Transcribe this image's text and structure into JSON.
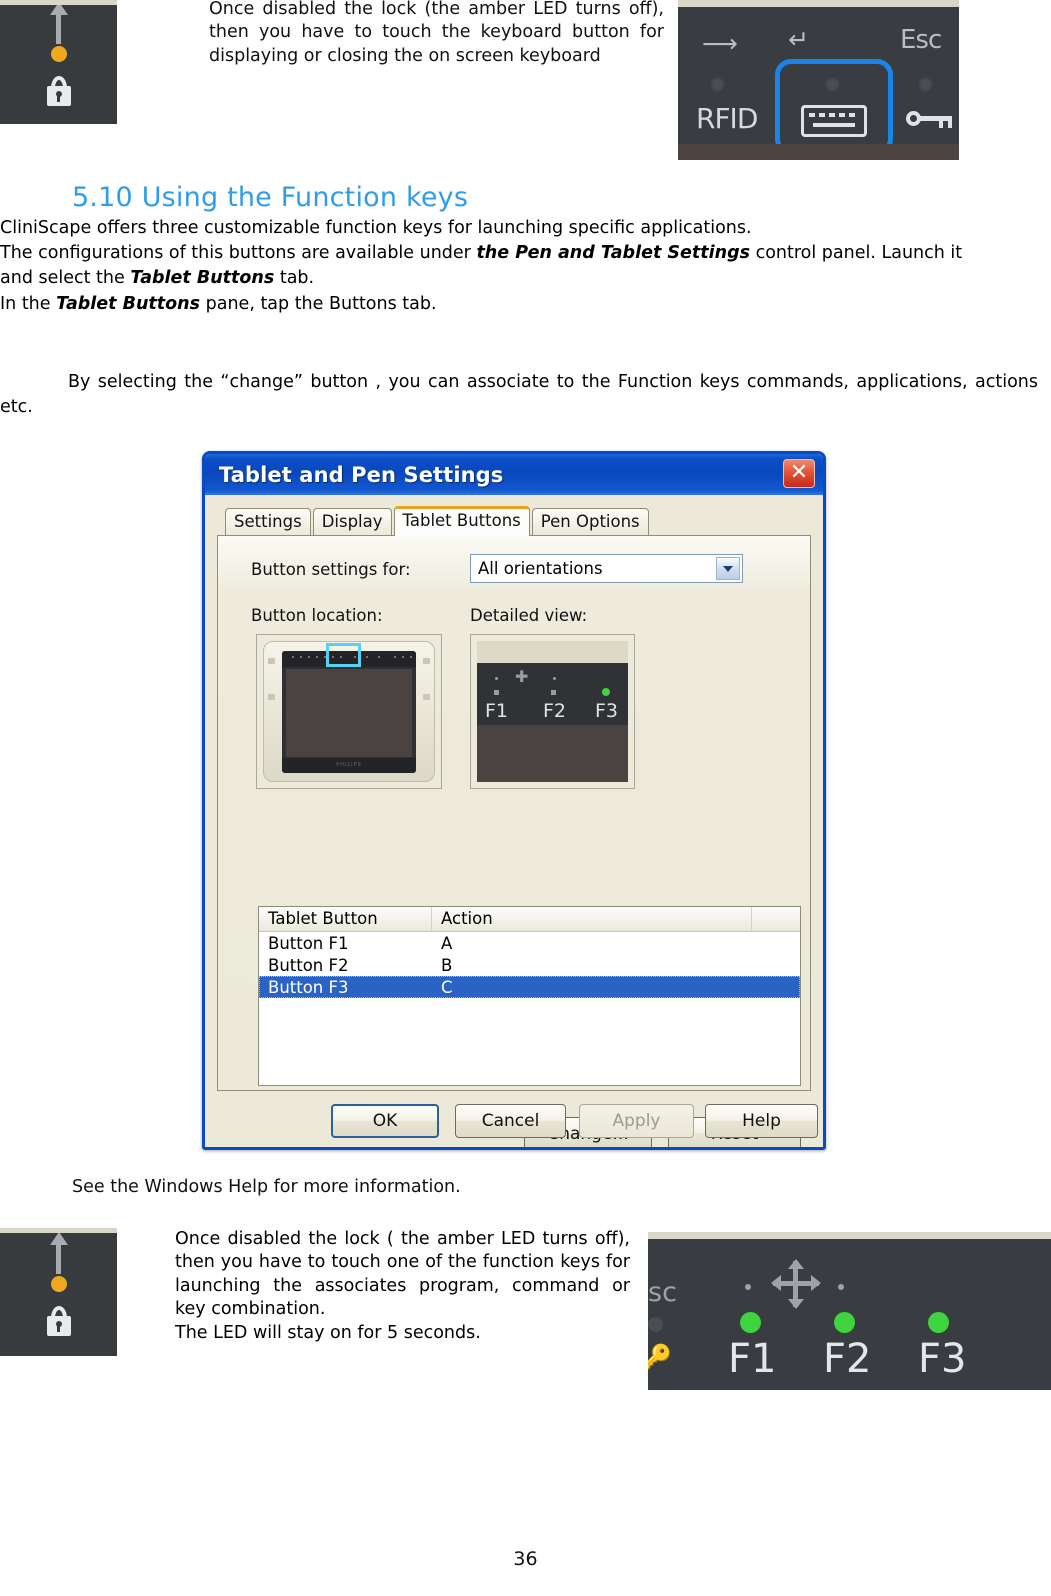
{
  "page": {
    "number": "36"
  },
  "top_section": {
    "paragraph": "Once disabled the lock (the amber LED turns off), then you have to touch the keyboard button for displaying or closing the on screen keyboard",
    "lock_photo": {
      "alt": "keypad lock indicator strip",
      "led_color": "#f0a81e",
      "background": "#383b3e"
    },
    "keyboard_photo": {
      "labels": [
        "RFID",
        "Esc"
      ],
      "highlight_color": "#1b84e8",
      "background": "#393c40"
    }
  },
  "heading": {
    "number": "5.10",
    "text": "5.10 Using the Function keys",
    "color": "#2f9de8"
  },
  "body": {
    "line1": "CliniScape offers three customizable function keys for launching specific applications.",
    "line2_a": "The configurations of this buttons are available under ",
    "line2_b": "the Pen and Tablet Settings",
    "line2_c": " control panel. Launch it",
    "line3_a": "and select the ",
    "line3_b": "Tablet Buttons",
    "line3_c": " tab.",
    "line4_a": "In the ",
    "line4_b": "Tablet Buttons",
    "line4_c": " pane, tap the Buttons tab.",
    "paragraph_change": "By selecting the “change” button , you can associate to the Function keys  commands, applications, actions etc."
  },
  "dialog": {
    "title": "Tablet and Pen Settings",
    "close_label": "✕",
    "tabs": [
      {
        "label": "Settings",
        "active": false
      },
      {
        "label": "Display",
        "active": false
      },
      {
        "label": "Tablet Buttons",
        "active": true
      },
      {
        "label": "Pen Options",
        "active": false
      }
    ],
    "fields": {
      "button_settings_label": "Button settings for:",
      "button_settings_value": "All orientations",
      "button_location_label": "Button location:",
      "detailed_view_label": "Detailed view:"
    },
    "detailed_view": {
      "keys": [
        "F1",
        "F2",
        "F3"
      ],
      "led_color": "#3fd33f"
    },
    "list": {
      "headers": [
        "Tablet Button",
        "Action"
      ],
      "rows": [
        {
          "button": "Button F1",
          "action": "A",
          "selected": false
        },
        {
          "button": "Button F2",
          "action": "B",
          "selected": false
        },
        {
          "button": "Button F3",
          "action": "C",
          "selected": true
        }
      ],
      "selection_color": "#2a63c4"
    },
    "buttons": {
      "change": "Change...",
      "reset": "Reset",
      "ok": "OK",
      "cancel": "Cancel",
      "apply": "Apply",
      "help": "Help",
      "apply_disabled": true
    }
  },
  "see_help": "See the Windows Help for more information.",
  "bottom_section": {
    "paragraph_a": "Once disabled the lock ( the amber LED turns off), then you have to touch one of the function keys for launching the associates program, command or key combination.",
    "paragraph_b": "The LED will stay on for 5  seconds.",
    "lock_photo": {
      "alt": "keypad lock indicator strip",
      "led_color": "#f0a81e"
    },
    "function_photo": {
      "keys": [
        "F1",
        "F2",
        "F3"
      ],
      "esc_label": "sc",
      "led_color": "#3fd33f",
      "background": "#393c40"
    }
  }
}
